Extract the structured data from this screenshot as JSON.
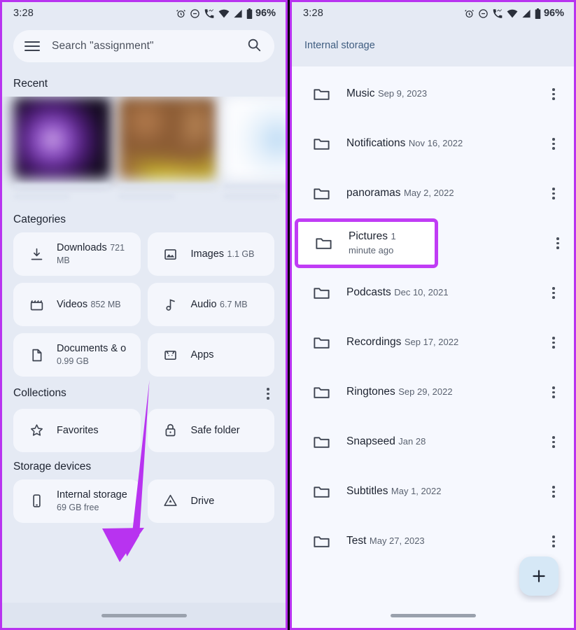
{
  "status_bar": {
    "time": "3:28",
    "battery_percent": "96%",
    "icons": [
      "alarm-icon",
      "do-not-disturb-icon",
      "missed-call-icon",
      "wifi-icon",
      "cellular-signal-icon",
      "battery-icon"
    ]
  },
  "left_screen": {
    "search": {
      "placeholder": "Search \"assignment\"",
      "menu_icon": "hamburger-menu-icon",
      "search_icon": "search-icon"
    },
    "recent": {
      "title": "Recent",
      "items": [
        {
          "id": "recent-thumb-1"
        },
        {
          "id": "recent-thumb-2"
        },
        {
          "id": "recent-thumb-3"
        }
      ]
    },
    "categories": {
      "title": "Categories",
      "items": [
        {
          "label": "Downloads",
          "size": "721 MB",
          "icon": "download-icon"
        },
        {
          "label": "Images",
          "size": "1.1 GB",
          "icon": "image-icon"
        },
        {
          "label": "Videos",
          "size": "852 MB",
          "icon": "video-icon"
        },
        {
          "label": "Audio",
          "size": "6.7 MB",
          "icon": "audio-note-icon"
        },
        {
          "label": "Documents & o",
          "size": "0.99 GB",
          "icon": "document-icon"
        },
        {
          "label": "Apps",
          "size": "",
          "icon": "android-apps-icon"
        }
      ]
    },
    "collections": {
      "title": "Collections",
      "overflow_icon": "more-vert-icon",
      "items": [
        {
          "label": "Favorites",
          "icon": "star-icon"
        },
        {
          "label": "Safe folder",
          "icon": "lock-icon"
        }
      ]
    },
    "storage_devices": {
      "title": "Storage devices",
      "items": [
        {
          "label": "Internal storage",
          "size": "69 GB free",
          "icon": "phone-icon"
        },
        {
          "label": "Drive",
          "size": "",
          "icon": "google-drive-icon"
        }
      ]
    }
  },
  "right_screen": {
    "breadcrumb": "Internal storage",
    "fab": {
      "icon": "plus-icon",
      "label": "+"
    },
    "files": [
      {
        "name": "Music",
        "date": "Sep 9, 2023",
        "highlighted": false
      },
      {
        "name": "Notifications",
        "date": "Nov 16, 2022",
        "highlighted": false
      },
      {
        "name": "panoramas",
        "date": "May 2, 2022",
        "highlighted": false
      },
      {
        "name": "Pictures",
        "date": "1 minute ago",
        "highlighted": true
      },
      {
        "name": "Podcasts",
        "date": "Dec 10, 2021",
        "highlighted": false
      },
      {
        "name": "Recordings",
        "date": "Sep 17, 2022",
        "highlighted": false
      },
      {
        "name": "Ringtones",
        "date": "Sep 29, 2022",
        "highlighted": false
      },
      {
        "name": "Snapseed",
        "date": "Jan 28",
        "highlighted": false
      },
      {
        "name": "Subtitles",
        "date": "May 1, 2022",
        "highlighted": false
      },
      {
        "name": "Test",
        "date": "May 27, 2023",
        "highlighted": false
      }
    ]
  },
  "annotations": {
    "highlight_color": "#c03cf5",
    "arrow_color": "#b833f0",
    "border_color": "#b833f0"
  }
}
